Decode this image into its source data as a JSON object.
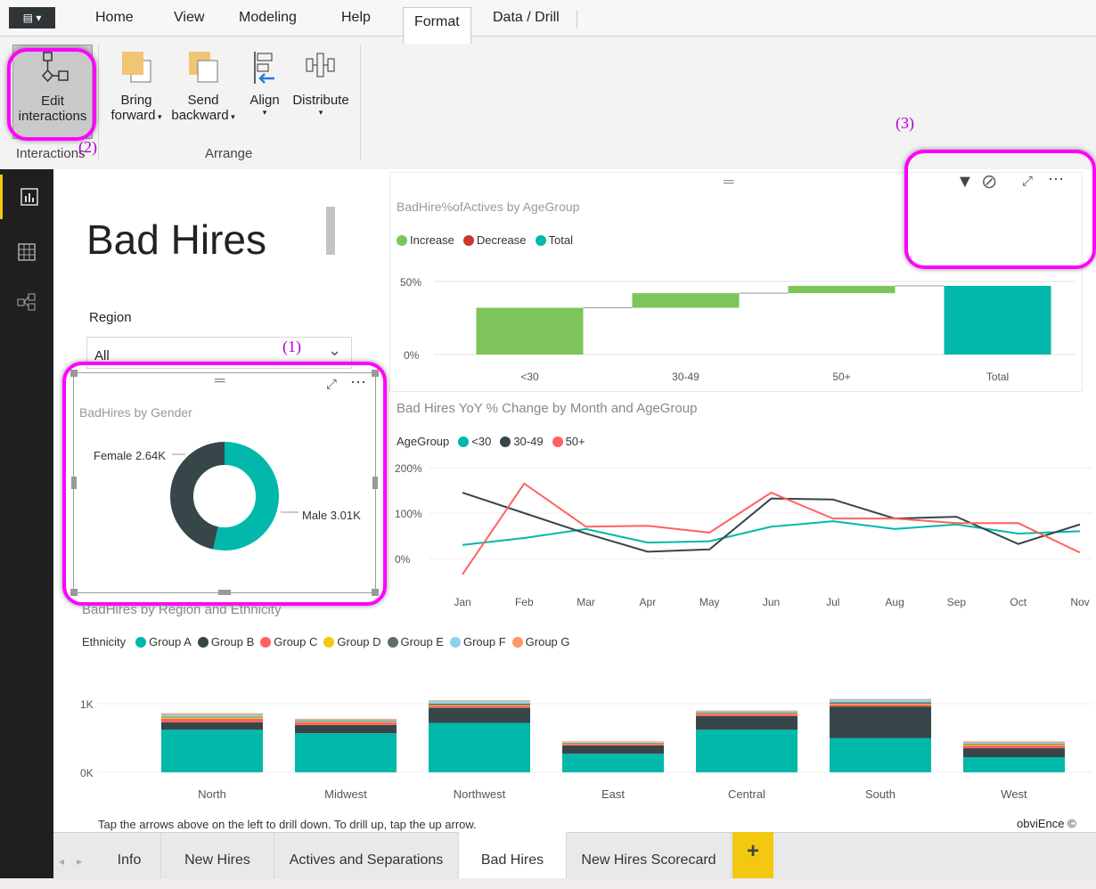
{
  "ribbon": {
    "tabs": [
      "Home",
      "View",
      "Modeling",
      "Help",
      "Format",
      "Data / Drill"
    ],
    "active_tab": "Format",
    "buttons": {
      "edit_interactions": "Edit\ninteractions",
      "edit_line1": "Edit",
      "edit_line2": "interactions",
      "bring_forward_1": "Bring",
      "bring_forward_2": "forward",
      "send_backward_1": "Send",
      "send_backward_2": "backward",
      "align": "Align",
      "distribute": "Distribute"
    },
    "groups": {
      "interactions": "Interactions",
      "arrange": "Arrange"
    }
  },
  "annotations": {
    "one": "(1)",
    "two": "(2)",
    "three": "(3)"
  },
  "report": {
    "title": "Bad Hires",
    "slicer": {
      "label": "Region",
      "value": "All"
    },
    "footer_note": "Tap the arrows above on the left to drill down. To drill up, tap the up arrow.",
    "copyright": "obviEnce ©"
  },
  "waterfall": {
    "title": "BadHire%ofActives by AgeGroup",
    "legend": [
      "Increase",
      "Decrease",
      "Total"
    ],
    "colors": {
      "increase": "#7dc55a",
      "decrease": "#c7382e",
      "total": "#01b8aa"
    },
    "yticks": [
      "50%",
      "0%"
    ]
  },
  "donut": {
    "title": "BadHires by Gender",
    "female_label": "Female 2.64K",
    "male_label": "Male 3.01K"
  },
  "line": {
    "title": "Bad Hires YoY % Change by Month and AgeGroup",
    "legend_title": "AgeGroup",
    "legend": [
      "<30",
      "30-49",
      "50+"
    ],
    "yticks": [
      "200%",
      "100%",
      "0%"
    ]
  },
  "bars": {
    "title": "BadHires by Region and Ethnicity",
    "legend_title": "Ethnicity",
    "legend": [
      "Group A",
      "Group B",
      "Group C",
      "Group D",
      "Group E",
      "Group F",
      "Group G"
    ],
    "yticks": [
      "1K",
      "0K"
    ]
  },
  "page_tabs": [
    "Info",
    "New Hires",
    "Actives and Separations",
    "Bad Hires",
    "New Hires Scorecard"
  ],
  "active_page": "Bad Hires",
  "chart_data": [
    {
      "type": "bar",
      "title": "BadHire%ofActives by AgeGroup",
      "categories": [
        "<30",
        "30-49",
        "50+",
        "Total"
      ],
      "series": [
        {
          "name": "Increase",
          "values": [
            32,
            10,
            5,
            null
          ]
        },
        {
          "name": "Total",
          "values": [
            null,
            null,
            null,
            47
          ]
        }
      ],
      "ylim": [
        0,
        60
      ],
      "legend": "top-left"
    },
    {
      "type": "pie",
      "title": "BadHires by Gender",
      "categories": [
        "Female",
        "Male"
      ],
      "values": [
        2640,
        3010
      ]
    },
    {
      "type": "line",
      "title": "Bad Hires YoY % Change by Month and AgeGroup",
      "x": [
        "Jan",
        "Feb",
        "Mar",
        "Apr",
        "May",
        "Jun",
        "Jul",
        "Aug",
        "Sep",
        "Oct",
        "Nov"
      ],
      "series": [
        {
          "name": "<30",
          "values": [
            30,
            45,
            65,
            35,
            38,
            70,
            82,
            65,
            75,
            55,
            60
          ],
          "color": "#01b8aa"
        },
        {
          "name": "30-49",
          "values": [
            145,
            100,
            55,
            15,
            20,
            132,
            130,
            88,
            92,
            32,
            75
          ],
          "color": "#374649"
        },
        {
          "name": "50+",
          "values": [
            -35,
            165,
            70,
            72,
            57,
            145,
            88,
            88,
            78,
            78,
            13
          ],
          "color": "#fd625e"
        }
      ],
      "ylim": [
        -40,
        200
      ],
      "legend": "top-left"
    },
    {
      "type": "bar",
      "title": "BadHires by Region and Ethnicity",
      "categories": [
        "North",
        "Midwest",
        "Northwest",
        "East",
        "Central",
        "South",
        "West"
      ],
      "series": [
        {
          "name": "Group A",
          "values": [
            620,
            570,
            720,
            270,
            620,
            500,
            220
          ],
          "color": "#01b8aa"
        },
        {
          "name": "Group B",
          "values": [
            110,
            120,
            220,
            120,
            200,
            460,
            130
          ],
          "color": "#374649"
        },
        {
          "name": "Group C",
          "values": [
            50,
            40,
            30,
            20,
            30,
            30,
            40
          ],
          "color": "#fd625e"
        },
        {
          "name": "Group D",
          "values": [
            20,
            10,
            10,
            10,
            10,
            10,
            15
          ],
          "color": "#f2c80f"
        },
        {
          "name": "Group E",
          "values": [
            10,
            10,
            20,
            10,
            10,
            20,
            10
          ],
          "color": "#5f6b6d"
        },
        {
          "name": "Group F",
          "values": [
            30,
            20,
            40,
            10,
            20,
            40,
            20
          ],
          "color": "#8ad4eb"
        },
        {
          "name": "Group G",
          "values": [
            20,
            10,
            10,
            10,
            10,
            10,
            15
          ],
          "color": "#fe9666"
        }
      ],
      "ylim": [
        0,
        1100
      ],
      "legend": "top-left"
    }
  ]
}
